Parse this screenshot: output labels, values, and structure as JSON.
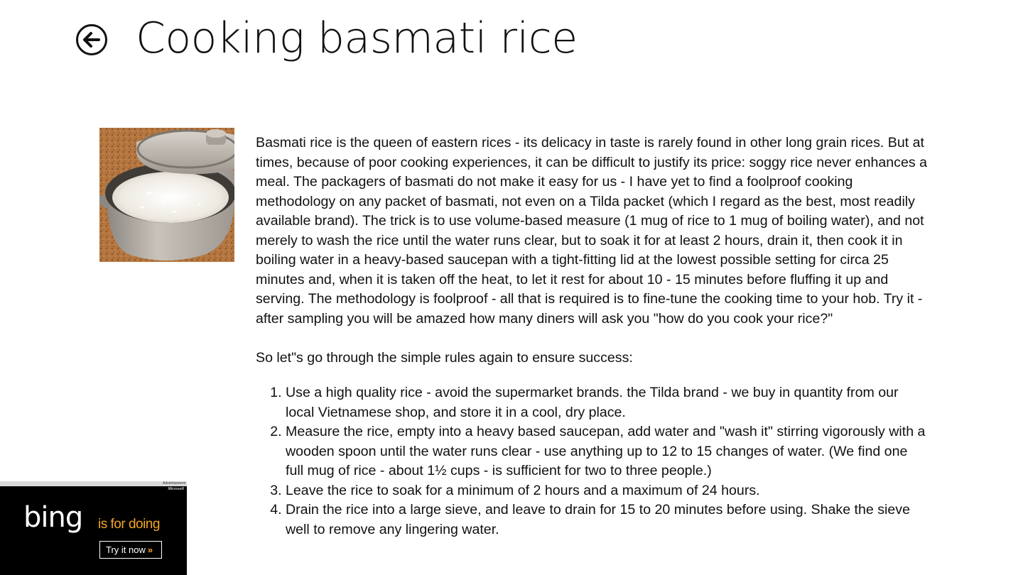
{
  "page": {
    "title": "Cooking basmati rice"
  },
  "icons": {
    "back": "back-arrow-icon",
    "cta_arrow": "double-chevron-right-icon"
  },
  "article": {
    "intro": "Basmati rice is the queen of eastern rices - its delicacy in taste is rarely found in other long grain rices. But at times, because of poor cooking experiences, it can be difficult to justify its price: soggy rice never enhances a meal. The packagers of basmati do not make it easy for us - I have yet to find a foolproof cooking methodology on any packet of basmati, not even on a Tilda packet (which I regard as the best, most readily available brand). The trick is to use volume-based measure (1 mug of rice to 1 mug of boiling water), and not merely to wash the rice until the water runs clear, but to soak it for at least 2 hours, drain it, then cook it in boiling water in a heavy-based saucepan with a tight-fitting lid at the lowest possible setting for circa 25 minutes and, when it is taken off the heat, to let it rest for about 10 - 15 minutes before fluffing it up and serving. The methodology is foolproof - all that is required is to fine-tune the cooking time to your hob. Try it - after sampling you will be amazed how many diners will ask you \"how do you cook your rice?\"",
    "rules_intro": "So let\"s go through the simple rules again to ensure success:",
    "rules": [
      "Use a high quality rice - avoid the supermarket brands. the Tilda brand - we buy in quantity from our local Vietnamese shop, and store it in a cool, dry place.",
      "Measure the rice, empty into a heavy based saucepan, add water and \"wash it\" stirring vigorously with a wooden spoon until the water runs clear - use anything up to 12 to 15 changes of water. (We find one full mug of rice - about 1½ cups - is sufficient for two to three people.)",
      "Leave the rice to soak for a minimum of 2 hours and a maximum of 24 hours.",
      "Drain the rice into a large sieve, and leave to drain for 15 to 20 minutes before using. Shake the sieve well to remove any lingering water."
    ]
  },
  "ad": {
    "label": "Advertisement",
    "sponsor": "Microsoft",
    "brand": "bing",
    "tagline": "is for doing",
    "cta": "Try it now",
    "cta_arrow_glyph": "»",
    "colors": {
      "background": "#000000",
      "accent": "#f5a623",
      "text": "#ffffff"
    }
  }
}
